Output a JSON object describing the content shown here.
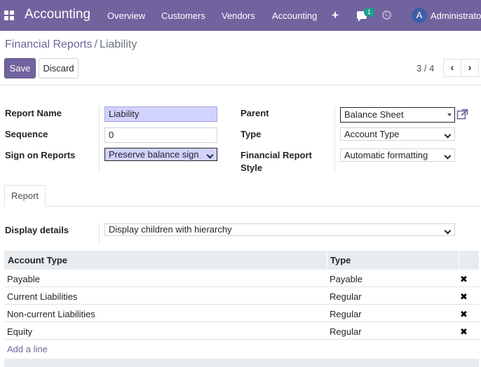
{
  "navbar": {
    "brand": "Accounting",
    "menu": [
      "Overview",
      "Customers",
      "Vendors",
      "Accounting"
    ],
    "chat_count": "1",
    "avatar_letter": "A",
    "username": "Administrator",
    "color": "#71639e"
  },
  "breadcrumb": {
    "parent": "Financial Reports",
    "separator": "/",
    "current": "Liability"
  },
  "buttons": {
    "save": "Save",
    "discard": "Discard"
  },
  "pager": {
    "value": "3 / 4"
  },
  "form": {
    "report_name_label": "Report Name",
    "report_name_value": "Liability",
    "sequence_label": "Sequence",
    "sequence_value": "0",
    "sign_label": "Sign on Reports",
    "sign_value": "Preserve balance sign",
    "parent_label": "Parent",
    "parent_value": "Balance Sheet",
    "type_label": "Type",
    "type_value": "Account Type",
    "style_label_line1": "Financial Report",
    "style_label_line2": "Style",
    "style_value": "Automatic formatting"
  },
  "tabs": [
    {
      "label": "Report",
      "active": true
    }
  ],
  "details": {
    "label": "Display details",
    "value": "Display children with hierarchy"
  },
  "table": {
    "headers": [
      "Account Type",
      "Type"
    ],
    "rows": [
      {
        "account_type": "Payable",
        "type": "Payable"
      },
      {
        "account_type": "Current Liabilities",
        "type": "Regular"
      },
      {
        "account_type": "Non-current Liabilities",
        "type": "Regular"
      },
      {
        "account_type": "Equity",
        "type": "Regular"
      }
    ],
    "delete_glyph": "✖",
    "add_line": "Add a line"
  },
  "icons": [
    "apps-icon",
    "plus-icon",
    "chat-icon",
    "clock-icon",
    "external-link-icon",
    "chevron-left-icon",
    "chevron-right-icon",
    "delete-icon"
  ]
}
